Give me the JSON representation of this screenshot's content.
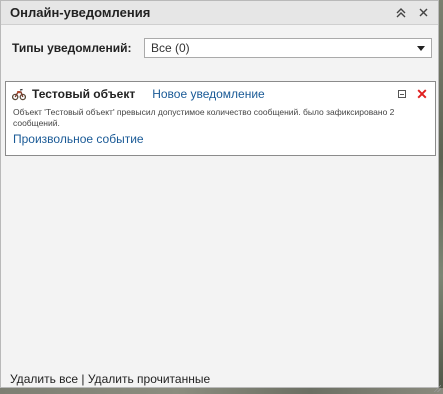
{
  "panel": {
    "title": "Онлайн-уведомления",
    "collapse_icon": "double-chevron-up-icon",
    "close_icon": "close-icon"
  },
  "filter": {
    "label": "Типы уведомлений:",
    "selected": "Все (0)"
  },
  "notifications": [
    {
      "object_icon": "motorcycle-icon",
      "object_name": "Тестовый объект",
      "type": "Новое уведомление",
      "message": "Объект 'Тестовый объект' превысил допустимое количество сообщений. было зафиксировано 2 сообщений.",
      "event": "Произвольное событие"
    }
  ],
  "footer": {
    "delete_all": "Удалить все",
    "separator": "|",
    "delete_read": "Удалить прочитанные"
  },
  "colors": {
    "link": "#1a5a96",
    "close_red": "#e02020",
    "panel_bg": "#f3f3f3",
    "titlebar_bg": "#e6e6e6"
  }
}
